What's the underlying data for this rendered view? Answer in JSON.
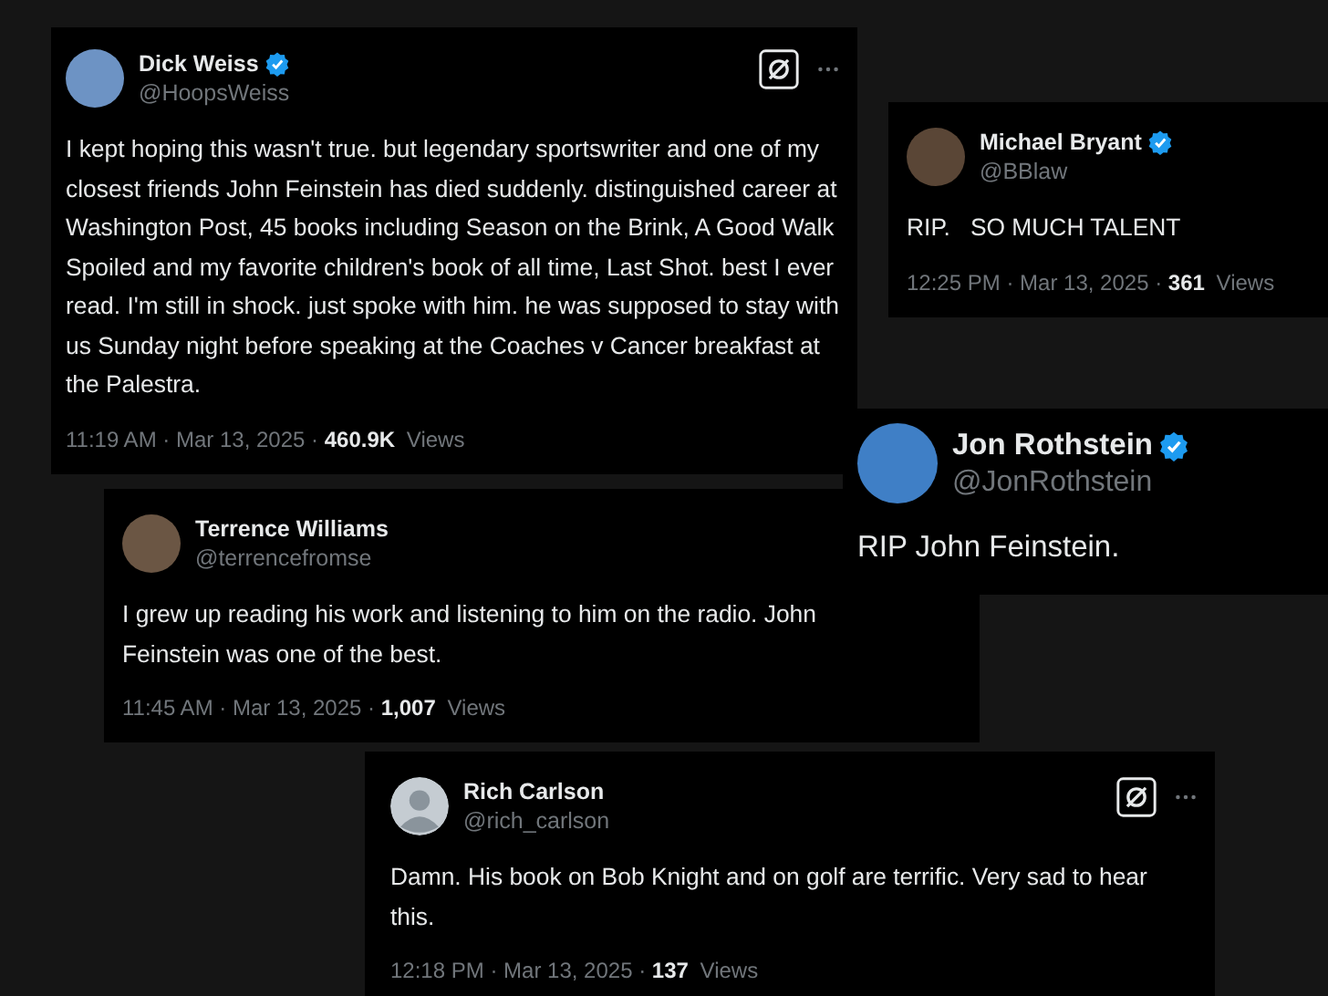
{
  "tweets": [
    {
      "name": "Dick Weiss",
      "handle": "@HoopsWeiss",
      "verified": true,
      "kind": "photo",
      "grok": true,
      "more": true,
      "text": "I kept hoping this wasn't true. but legendary sportswriter and one of my closest friends John Feinstein has died suddenly. distinguished career at Washington Post, 45 books including Season on the Brink, A Good Walk Spoiled and my favorite children's book of all time, Last Shot. best I ever read. I'm still in shock. just spoke with him. he was supposed to stay with us Sunday night before speaking at the Coaches v Cancer breakfast at the Palestra.",
      "time": "11:19 AM · Mar 13, 2025 · ",
      "views_count": "460.9K",
      "views_label": "Views"
    },
    {
      "name": "Michael Bryant",
      "handle": "@BBlaw",
      "verified": true,
      "kind": "photo",
      "grok": false,
      "more": false,
      "text": "RIP.   SO MUCH TALENT",
      "time": "12:25 PM · Mar 13, 2025 · ",
      "views_count": "361",
      "views_label": "Views"
    },
    {
      "name": "Terrence Williams",
      "handle": "@terrencefromse",
      "verified": false,
      "kind": "photo",
      "grok": false,
      "more": false,
      "text": "I grew up reading his work and listening to him on the radio. John Feinstein was one of the best.",
      "time": "11:45 AM · Mar 13, 2025 · ",
      "views_count": "1,007",
      "views_label": "Views"
    },
    {
      "name": "Jon Rothstein",
      "handle": "@JonRothstein",
      "verified": true,
      "kind": "photo",
      "grok": false,
      "more": false,
      "text": "RIP John Feinstein."
    },
    {
      "name": "Rich Carlson",
      "handle": "@rich_carlson",
      "verified": false,
      "kind": "silhouette",
      "grok": true,
      "more": true,
      "text": "Damn. His book on Bob Knight and on golf are terrific. Very sad to hear this.",
      "time": "12:18 PM · Mar 13, 2025 · ",
      "views_count": "137",
      "views_label": "Views"
    }
  ]
}
